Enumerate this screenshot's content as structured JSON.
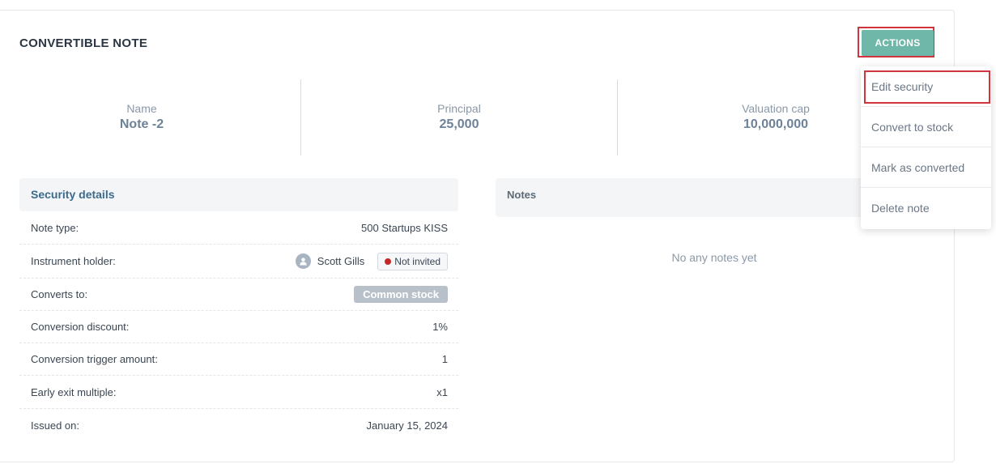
{
  "card": {
    "title": "CONVERTIBLE NOTE",
    "actions_label": "ACTIONS"
  },
  "stats": [
    {
      "label": "Name",
      "value": "Note -2"
    },
    {
      "label": "Principal",
      "value": "25,000"
    },
    {
      "label": "Valuation cap",
      "value": "10,000,000"
    }
  ],
  "security_details": {
    "title": "Security details",
    "rows": [
      {
        "label": "Note type:",
        "value": "500 Startups KISS"
      },
      {
        "label": "Instrument holder:",
        "holder_name": "Scott Gills",
        "status": "Not invited"
      },
      {
        "label": "Converts to:",
        "value": "Common stock"
      },
      {
        "label": "Conversion discount:",
        "value": "1%"
      },
      {
        "label": "Conversion trigger amount:",
        "value": "1"
      },
      {
        "label": "Early exit multiple:",
        "value": "x1"
      },
      {
        "label": "Issued on:",
        "value": "January 15, 2024"
      }
    ]
  },
  "notes": {
    "title": "Notes",
    "empty_text": "No any notes yet"
  },
  "actions_menu": {
    "items": [
      {
        "label": "Edit security"
      },
      {
        "label": "Convert to stock"
      },
      {
        "label": "Mark as converted"
      },
      {
        "label": "Delete note"
      }
    ]
  },
  "colors": {
    "accent": "#6fb7a8",
    "highlight": "#d0343c",
    "status_not_invited": "#c62828",
    "tag_bg": "#b8c0ca"
  }
}
